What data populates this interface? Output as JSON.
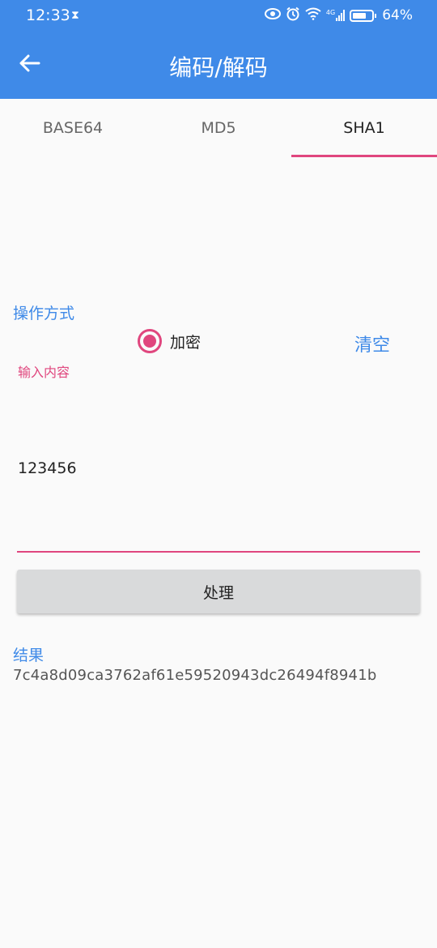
{
  "status_bar": {
    "time": "12:33",
    "network": "4G",
    "battery": "64%"
  },
  "app_bar": {
    "title": "编码/解码"
  },
  "tabs": [
    {
      "label": "BASE64",
      "active": false
    },
    {
      "label": "MD5",
      "active": false
    },
    {
      "label": "SHA1",
      "active": true
    }
  ],
  "form": {
    "operation_label": "操作方式",
    "option_encrypt": "加密",
    "clear_label": "清空",
    "input_label": "输入内容",
    "input_value": "123456",
    "process_label": "处理",
    "result_label": "结果",
    "result_value": "7c4a8d09ca3762af61e59520943dc26494f8941b"
  },
  "colors": {
    "primary": "#3f8ae8",
    "accent": "#e0467e"
  }
}
